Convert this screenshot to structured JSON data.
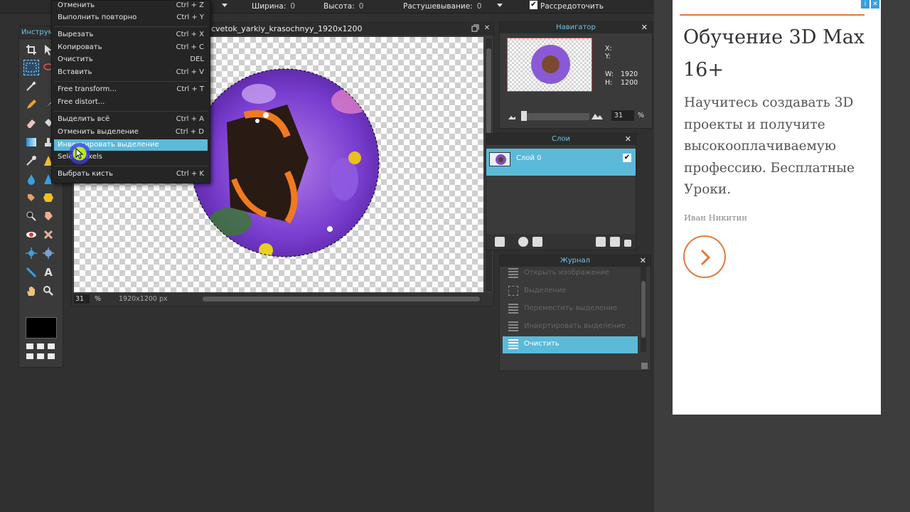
{
  "toolbar": {
    "width_label": "Ширина:",
    "width_value": "0",
    "height_label": "Высота:",
    "height_value": "0",
    "feather_label": "Растушевывание:",
    "feather_value": "0",
    "distribute_label": "Рассредоточить",
    "distribute_checked": true
  },
  "tools_panel": {
    "title": "Инструм",
    "icons": [
      "crop-icon",
      "move-icon",
      "marquee-icon",
      "lasso-icon",
      "wand-icon",
      "pencil-icon",
      "brush-icon",
      "eraser-icon",
      "bucket-icon",
      "gradient-icon",
      "stamp-icon",
      "picker-icon",
      "drop-icon",
      "sharpen-icon",
      "smudge-icon",
      "sponge-icon",
      "burn-icon",
      "dodge-icon",
      "redeye-icon",
      "spot-heal-icon",
      "bloat-icon",
      "pinch-icon",
      "line-tool-icon",
      "type-tool-icon",
      "hand-icon",
      "zoom-icon"
    ],
    "foreground_color": "#000000",
    "type_tool_glyph": "A"
  },
  "canvas_window": {
    "title": "cvetok_yarkiy_krasochnyy_1920x1200",
    "zoom": "31",
    "percent_sign": "%",
    "dimensions": "1920x1200 px"
  },
  "edit_menu": {
    "items": [
      {
        "label": "Отменить",
        "shortcut": "Ctrl + Z"
      },
      {
        "label": "Выполнить повторно",
        "shortcut": "Ctrl + Y"
      },
      {
        "label": "Вырезать",
        "shortcut": "Ctrl + X"
      },
      {
        "label": "Копировать",
        "shortcut": "Ctrl + C"
      },
      {
        "label": "Очистить",
        "shortcut": "DEL"
      },
      {
        "label": "Вставить",
        "shortcut": "Ctrl + V"
      },
      {
        "label": "Free transform...",
        "shortcut": "Ctrl + T"
      },
      {
        "label": "Free distort...",
        "shortcut": ""
      },
      {
        "label": "Выделить всё",
        "shortcut": "Ctrl + A"
      },
      {
        "label": "Отменить выделение",
        "shortcut": "Ctrl + D"
      },
      {
        "label": "Инвертировать выделение",
        "shortcut": ""
      },
      {
        "label": "Select pixels",
        "shortcut": ""
      },
      {
        "label": "Выбрать кисть",
        "shortcut": "Ctrl + K"
      }
    ],
    "highlighted_item": "Инвертировать выделение"
  },
  "navigator": {
    "title": "Навигатор",
    "x_label": "X:",
    "y_label": "Y:",
    "w_label": "W:",
    "w_value": "1920",
    "h_label": "H:",
    "h_value": "1200",
    "zoom": "31",
    "percent_sign": "%"
  },
  "layers": {
    "title": "Слои",
    "items": [
      {
        "name": "Слой 0",
        "visible": true,
        "selected": true
      }
    ]
  },
  "history": {
    "title": "Журнал",
    "items": [
      {
        "label": "Открыть изображение",
        "icon": "document-icon",
        "active": false
      },
      {
        "label": "Выделение",
        "icon": "selection-icon",
        "active": false
      },
      {
        "label": "Переместить выделение",
        "icon": "document-icon",
        "active": false
      },
      {
        "label": "Инвертировать выделение",
        "icon": "document-icon",
        "active": false
      },
      {
        "label": "Очистить",
        "icon": "document-icon",
        "active": true
      }
    ]
  },
  "ad": {
    "title": "Обучение 3D Max 16+",
    "body": "Научитесь создавать 3D проекты и получите высокооплачиваемую профессию. Бесплатные Уроки.",
    "author": "Иван Никитин",
    "accent_color": "#e07a3a"
  },
  "colors": {
    "highlight": "#5bbad8",
    "panel_title": "#6fc3e8",
    "background": "#303030"
  }
}
